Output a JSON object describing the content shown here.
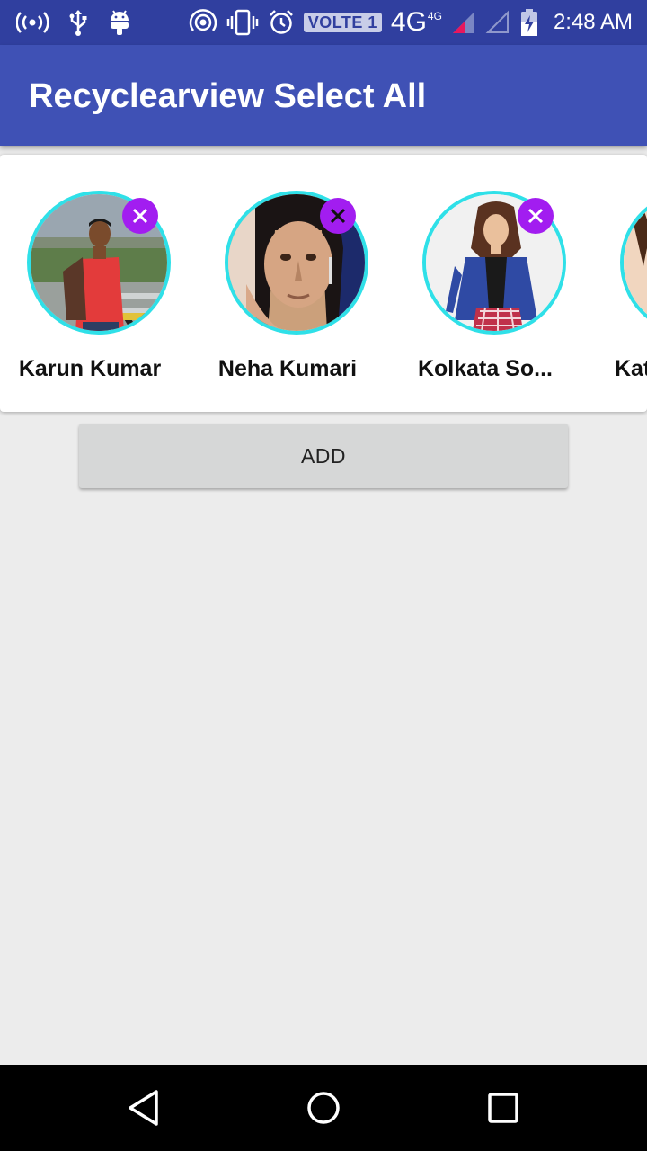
{
  "status_bar": {
    "time": "2:48 AM",
    "volte": "VOLTE 1",
    "network": "4G",
    "network_sup": "4G",
    "icons": [
      "hotspot-icon",
      "usb-icon",
      "android-debug-icon",
      "wifi-calling-icon",
      "vibrate-icon",
      "alarm-icon",
      "signal-icon",
      "signal-empty-icon",
      "battery-charging-icon"
    ]
  },
  "app_bar": {
    "title": "Recyclearview Select All"
  },
  "contacts": [
    {
      "name": "Karun Kumar"
    },
    {
      "name": "Neha Kumari"
    },
    {
      "name": "Kolkata So..."
    },
    {
      "name": "Kat"
    }
  ],
  "actions": {
    "add_label": "ADD"
  },
  "colors": {
    "status_bar": "#303f9f",
    "app_bar": "#3f51b5",
    "avatar_ring": "#2fe0e8",
    "remove_badge": "#a21df0",
    "background": "#ececec"
  },
  "nav_bar": {
    "icons": [
      "back-icon",
      "home-icon",
      "recents-icon"
    ]
  }
}
